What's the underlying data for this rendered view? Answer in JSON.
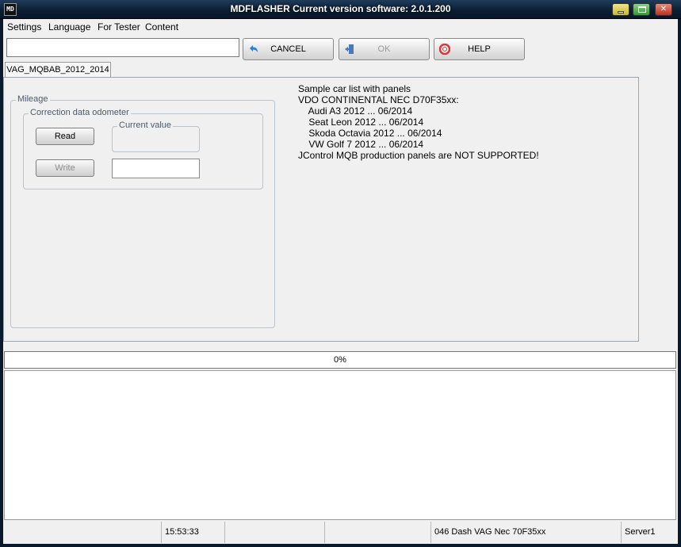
{
  "window": {
    "title": "MDFLASHER  Current version software: 2.0.1.200",
    "icon_label": "MD"
  },
  "menu": [
    "Settings",
    "Language",
    "For Tester",
    "Content"
  ],
  "toolbar": {
    "search_value": "",
    "cancel_label": "CANCEL",
    "ok_label": "OK",
    "help_label": "HELP"
  },
  "tabs": [
    {
      "label": "VAG_MQBAB_2012_2014",
      "active": true
    }
  ],
  "mileage": {
    "group_title": "Mileage",
    "correction_title": "Correction data odometer",
    "current_value_title": "Current value",
    "read_label": "Read",
    "write_label": "Write",
    "current_value": "",
    "write_value": ""
  },
  "info": {
    "lines": [
      "Sample car list with panels",
      "VDO CONTINENTAL NEC D70F35xx:",
      "    Audi A3 2012 ... 06/2014",
      "    Seat Leon 2012 ... 06/2014",
      "    Skoda Octavia 2012 ... 06/2014",
      "    VW Golf 7 2012 ... 06/2014",
      "JControl MQB production panels are NOT SUPPORTED!"
    ]
  },
  "progress": {
    "percent": 0,
    "label": "0%"
  },
  "status": {
    "cells": [
      "",
      "15:53:33",
      "",
      "",
      "046 Dash VAG Nec 70F35xx",
      "Server1"
    ]
  },
  "colors": {
    "title_bar": "#0b1d30",
    "progress_fill": "#5ba04d"
  }
}
